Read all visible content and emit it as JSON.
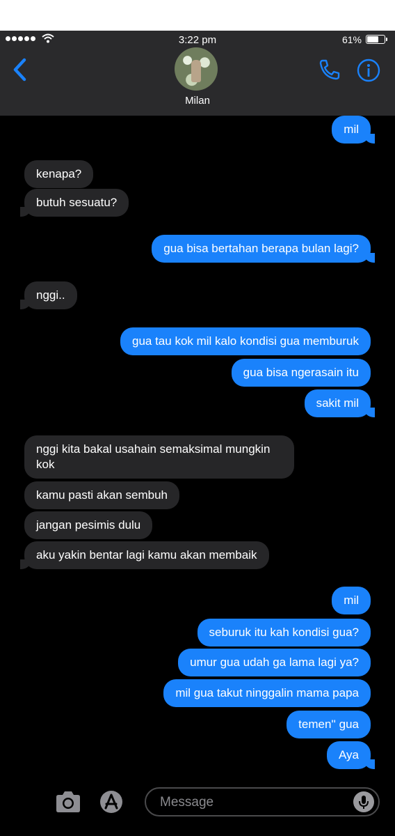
{
  "status_bar": {
    "time": "3:22 pm",
    "battery": "61%",
    "battery_level": 0.61
  },
  "header": {
    "contact_name": "Milan"
  },
  "icons": {
    "back": "chevron-left-icon",
    "phone": "phone-icon",
    "info": "info-icon",
    "camera": "camera-icon",
    "appstore": "app-store-icon",
    "mic": "microphone-icon"
  },
  "messages": [
    {
      "dir": "out",
      "text": "mil"
    },
    {
      "dir": "in",
      "text": "kenapa?"
    },
    {
      "dir": "in",
      "text": "butuh sesuatu?"
    },
    {
      "dir": "out",
      "text": "gua bisa bertahan berapa bulan lagi?"
    },
    {
      "dir": "in",
      "text": "nggi.."
    },
    {
      "dir": "out",
      "text": "gua tau kok mil kalo kondisi gua memburuk"
    },
    {
      "dir": "out",
      "text": "gua bisa ngerasain itu"
    },
    {
      "dir": "out",
      "text": "sakit mil"
    },
    {
      "dir": "in",
      "text": "nggi kita bakal usahain semaksimal mungkin kok"
    },
    {
      "dir": "in",
      "text": "kamu pasti akan sembuh"
    },
    {
      "dir": "in",
      "text": "jangan pesimis dulu"
    },
    {
      "dir": "in",
      "text": "aku yakin bentar lagi kamu akan membaik"
    },
    {
      "dir": "out",
      "text": "mil"
    },
    {
      "dir": "out",
      "text": "seburuk itu kah kondisi gua?"
    },
    {
      "dir": "out",
      "text": "umur gua udah ga lama lagi ya?"
    },
    {
      "dir": "out",
      "text": "mil gua takut ninggalin mama papa"
    },
    {
      "dir": "out",
      "text": "temen'' gua"
    },
    {
      "dir": "out",
      "text": "Aya"
    }
  ],
  "composer": {
    "placeholder": "Message",
    "value": ""
  },
  "colors": {
    "outgoing": "#1a82fb",
    "incoming": "#262628",
    "accent": "#1a82fb"
  }
}
